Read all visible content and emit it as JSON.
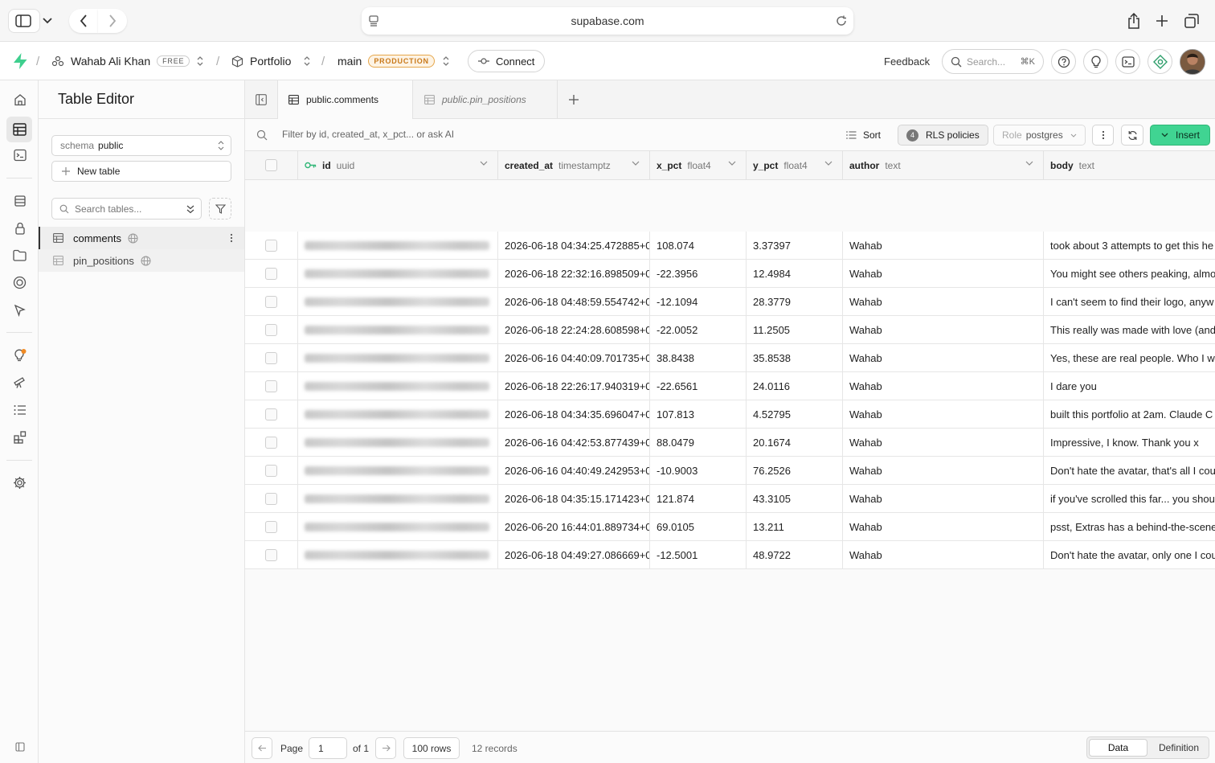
{
  "browser": {
    "url": "supabase.com"
  },
  "topbar": {
    "org": "Wahab Ali Khan",
    "org_plan": "FREE",
    "project": "Portfolio",
    "branch": "main",
    "branch_badge": "PRODUCTION",
    "connect": "Connect",
    "feedback": "Feedback",
    "search_placeholder": "Search...",
    "search_shortcut": "⌘K"
  },
  "sidebar": {
    "title": "Table Editor",
    "schema_label": "schema",
    "schema_value": "public",
    "new_table": "New table",
    "search_placeholder": "Search tables...",
    "tables": [
      {
        "name": "comments",
        "active": true
      },
      {
        "name": "pin_positions",
        "active": false
      }
    ]
  },
  "tabs": [
    {
      "label": "public.comments",
      "active": true
    },
    {
      "label": "public.pin_positions",
      "active": false
    }
  ],
  "toolbar": {
    "filter_placeholder": "Filter by id, created_at, x_pct... or ask AI",
    "sort": "Sort",
    "rls_count": "4",
    "rls": "RLS policies",
    "role_label": "Role",
    "role_value": "postgres",
    "insert": "Insert"
  },
  "columns": [
    {
      "name": "id",
      "type": "uuid"
    },
    {
      "name": "created_at",
      "type": "timestamptz"
    },
    {
      "name": "x_pct",
      "type": "float4"
    },
    {
      "name": "y_pct",
      "type": "float4"
    },
    {
      "name": "author",
      "type": "text"
    },
    {
      "name": "body",
      "type": "text"
    }
  ],
  "rows": [
    {
      "created_at": "2026-06-18 04:34:25.472885+0",
      "x_pct": "108.074",
      "y_pct": "3.37397",
      "author": "Wahab",
      "body": "took about 3 attempts to get this he"
    },
    {
      "created_at": "2026-06-18 22:32:16.898509+0",
      "x_pct": "-22.3956",
      "y_pct": "12.4984",
      "author": "Wahab",
      "body": "You might see others peaking, almo"
    },
    {
      "created_at": "2026-06-18 04:48:59.554742+0",
      "x_pct": "-12.1094",
      "y_pct": "28.3779",
      "author": "Wahab",
      "body": "I can't seem to find their logo, anyw"
    },
    {
      "created_at": "2026-06-18 22:24:28.608598+0",
      "x_pct": "-22.0052",
      "y_pct": "11.2505",
      "author": "Wahab",
      "body": "This really was made with love (and"
    },
    {
      "created_at": "2026-06-16 04:40:09.701735+0",
      "x_pct": "38.8438",
      "y_pct": "35.8538",
      "author": "Wahab",
      "body": "Yes, these are real people. Who I w"
    },
    {
      "created_at": "2026-06-18 22:26:17.940319+00",
      "x_pct": "-22.6561",
      "y_pct": "24.0116",
      "author": "Wahab",
      "body": "I dare you"
    },
    {
      "created_at": "2026-06-18 04:34:35.696047+0",
      "x_pct": "107.813",
      "y_pct": "4.52795",
      "author": "Wahab",
      "body": "built this portfolio at 2am. Claude C"
    },
    {
      "created_at": "2026-06-16 04:42:53.877439+0",
      "x_pct": "88.0479",
      "y_pct": "20.1674",
      "author": "Wahab",
      "body": "Impressive, I know. Thank you x"
    },
    {
      "created_at": "2026-06-16 04:40:49.242953+0",
      "x_pct": "-10.9003",
      "y_pct": "76.2526",
      "author": "Wahab",
      "body": "Don't hate the avatar, that's all I cou"
    },
    {
      "created_at": "2026-06-18 04:35:15.171423+00",
      "x_pct": "121.874",
      "y_pct": "43.3105",
      "author": "Wahab",
      "body": "if you've scrolled this far... you shou"
    },
    {
      "created_at": "2026-06-20 16:44:01.889734+0",
      "x_pct": "69.0105",
      "y_pct": "13.211",
      "author": "Wahab",
      "body": "psst, Extras has a behind-the-scene"
    },
    {
      "created_at": "2026-06-18 04:49:27.086669+0",
      "x_pct": "-12.5001",
      "y_pct": "48.9722",
      "author": "Wahab",
      "body": "Don't hate the avatar, only one I cou"
    }
  ],
  "footer": {
    "page_label": "Page",
    "page_value": "1",
    "of_label": "of 1",
    "rows_per_page": "100 rows",
    "records": "12 records",
    "data_tab": "Data",
    "definition_tab": "Definition"
  },
  "colors": {
    "brand": "#3ecf8e",
    "insert_bg": "#40d492",
    "production": "#c9791a"
  }
}
